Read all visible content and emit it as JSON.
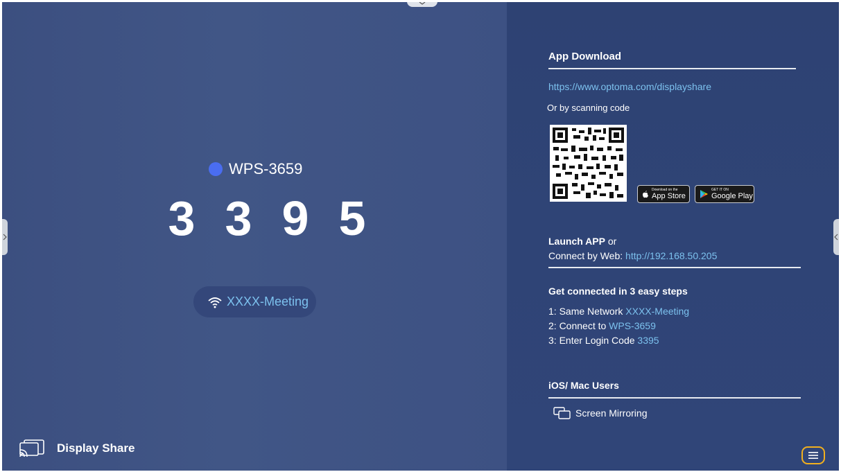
{
  "main": {
    "device_name": "WPS-3659",
    "login_code_digits": [
      "3",
      "3",
      "9",
      "5"
    ],
    "network_name": "XXXX-Meeting",
    "app_label": "Display Share"
  },
  "sidebar": {
    "app_download_heading": "App Download",
    "download_url": "https://www.optoma.com/displayshare",
    "scan_text": "Or by scanning code",
    "app_store": {
      "small": "Download on the",
      "big": "App Store"
    },
    "google_play": {
      "small": "GET IT ON",
      "big": "Google Play"
    },
    "launch_app": "Launch APP",
    "launch_or": " or",
    "connect_by_web": "Connect by Web: ",
    "web_address": "http://192.168.50.205",
    "steps_heading": "Get connected in 3 easy steps",
    "steps": [
      {
        "prefix": "1: Same Network ",
        "value": "XXXX-Meeting"
      },
      {
        "prefix": "2: Connect to ",
        "value": "WPS-3659"
      },
      {
        "prefix": "3: Enter Login Code ",
        "value": "3395"
      }
    ],
    "ios_heading": "iOS/ Mac Users",
    "screen_mirroring": "Screen Mirroring"
  },
  "colors": {
    "left_bg": "#3d5183",
    "right_bg": "#2f4476",
    "accent_link": "#7cc1ee",
    "status_dot": "#4a6df0",
    "menu_outline": "#f2b01e"
  },
  "icons": {
    "network": "wifi-icon",
    "cast": "cast-icon",
    "mirroring": "screen-mirroring-icon",
    "menu": "menu-icon"
  }
}
